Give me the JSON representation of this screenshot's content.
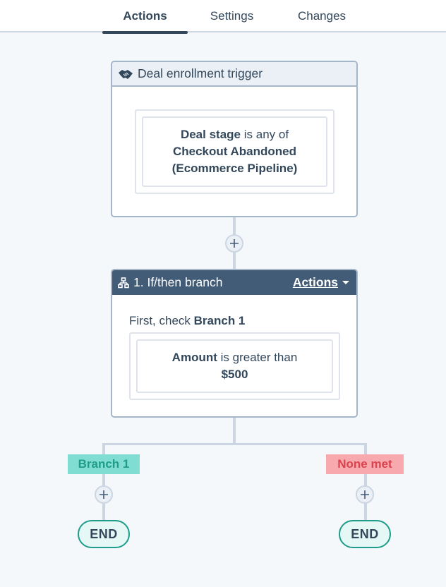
{
  "tabs": [
    {
      "label": "Actions",
      "active": true
    },
    {
      "label": "Settings",
      "active": false
    },
    {
      "label": "Changes",
      "active": false
    }
  ],
  "trigger": {
    "icon": "handshake-icon",
    "title": "Deal enrollment trigger",
    "filter": {
      "property": "Deal stage",
      "operator": "is any of",
      "value_line1": "Checkout Abandoned",
      "value_line2": "(Ecommerce Pipeline)"
    }
  },
  "add_action_label": "+",
  "branch_action": {
    "icon": "branch-icon",
    "title": "1. If/then branch",
    "actions_label": "Actions",
    "first_check_prefix": "First, check",
    "first_check_branch": "Branch 1",
    "filter": {
      "property": "Amount",
      "operator": "is greater than",
      "value": "$500"
    }
  },
  "branches": [
    {
      "label": "Branch 1",
      "color": "#7fded1",
      "text_color": "#1f9c8a",
      "end_label": "END"
    },
    {
      "label": "None met",
      "color": "#f8a9ad",
      "text_color": "#d9434f",
      "end_label": "END"
    }
  ],
  "colors": {
    "header_dark": "#425b76",
    "text": "#33475b",
    "connector": "#cbd6e2",
    "end_border": "#1f9c8a"
  }
}
